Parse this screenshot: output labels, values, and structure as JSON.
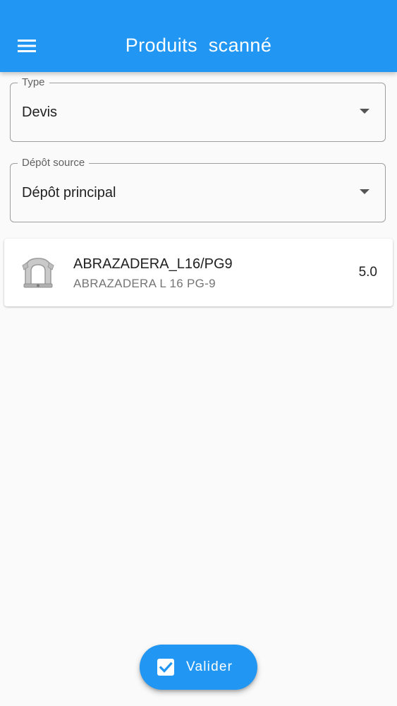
{
  "app_bar": {
    "title": "Produits  scanné",
    "menu_icon": "menu-icon",
    "color": "#2196f3"
  },
  "form": {
    "type_field": {
      "label": "Type",
      "value": "Devis"
    },
    "depot_field": {
      "label": "Dépôt source",
      "value": "Dépôt principal"
    }
  },
  "products": [
    {
      "name": "ABRAZADERA_L16/PG9",
      "description": "ABRAZADERA L 16 PG-9",
      "quantity": "5.0",
      "icon": "clamp-thumbnail"
    }
  ],
  "fab": {
    "label": "Valider",
    "icon": "check-box-icon",
    "color": "#2196f3"
  }
}
